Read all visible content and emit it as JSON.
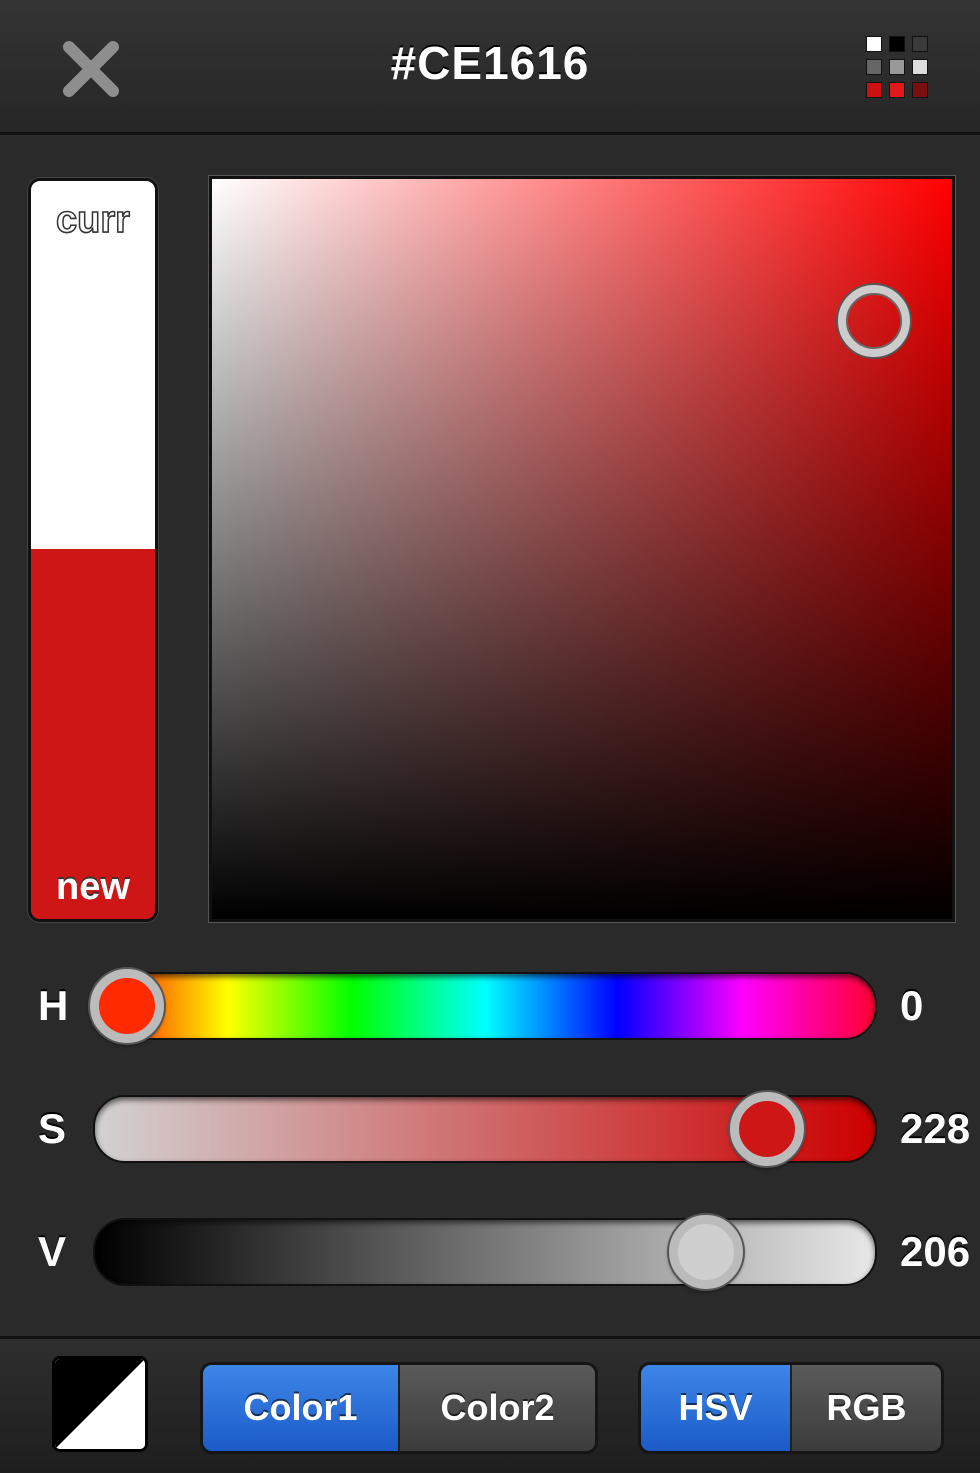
{
  "header": {
    "title": "#CE1616",
    "close_icon": "close-x-icon",
    "palette_icon": "palette-grid-icon",
    "palette_colors": [
      "#ffffff",
      "#000000",
      "#3a3a3a",
      "#666666",
      "#999999",
      "#dddddd",
      "#cc1111",
      "#e01a1a",
      "#7a0f0f"
    ]
  },
  "swatches": {
    "current_label": "curr",
    "new_label": "new",
    "current_color": "#ffffff",
    "new_color": "#ce1616"
  },
  "sv_picker": {
    "hue_color": "#ff0000",
    "saturation_fraction": 0.894,
    "value_fraction": 0.808
  },
  "sliders": [
    {
      "name": "h",
      "label": "H",
      "value": "0",
      "fraction": 0.0
    },
    {
      "name": "s",
      "label": "S",
      "value": "228",
      "fraction": 0.894
    },
    {
      "name": "v",
      "label": "V",
      "value": "206",
      "fraction": 0.808
    }
  ],
  "bottom": {
    "swap_icon": "black-white-swap-icon",
    "color_tabs": [
      {
        "label": "Color1",
        "active": true
      },
      {
        "label": "Color2",
        "active": false
      }
    ],
    "mode_tabs": [
      {
        "label": "HSV",
        "active": true
      },
      {
        "label": "RGB",
        "active": false
      }
    ]
  }
}
